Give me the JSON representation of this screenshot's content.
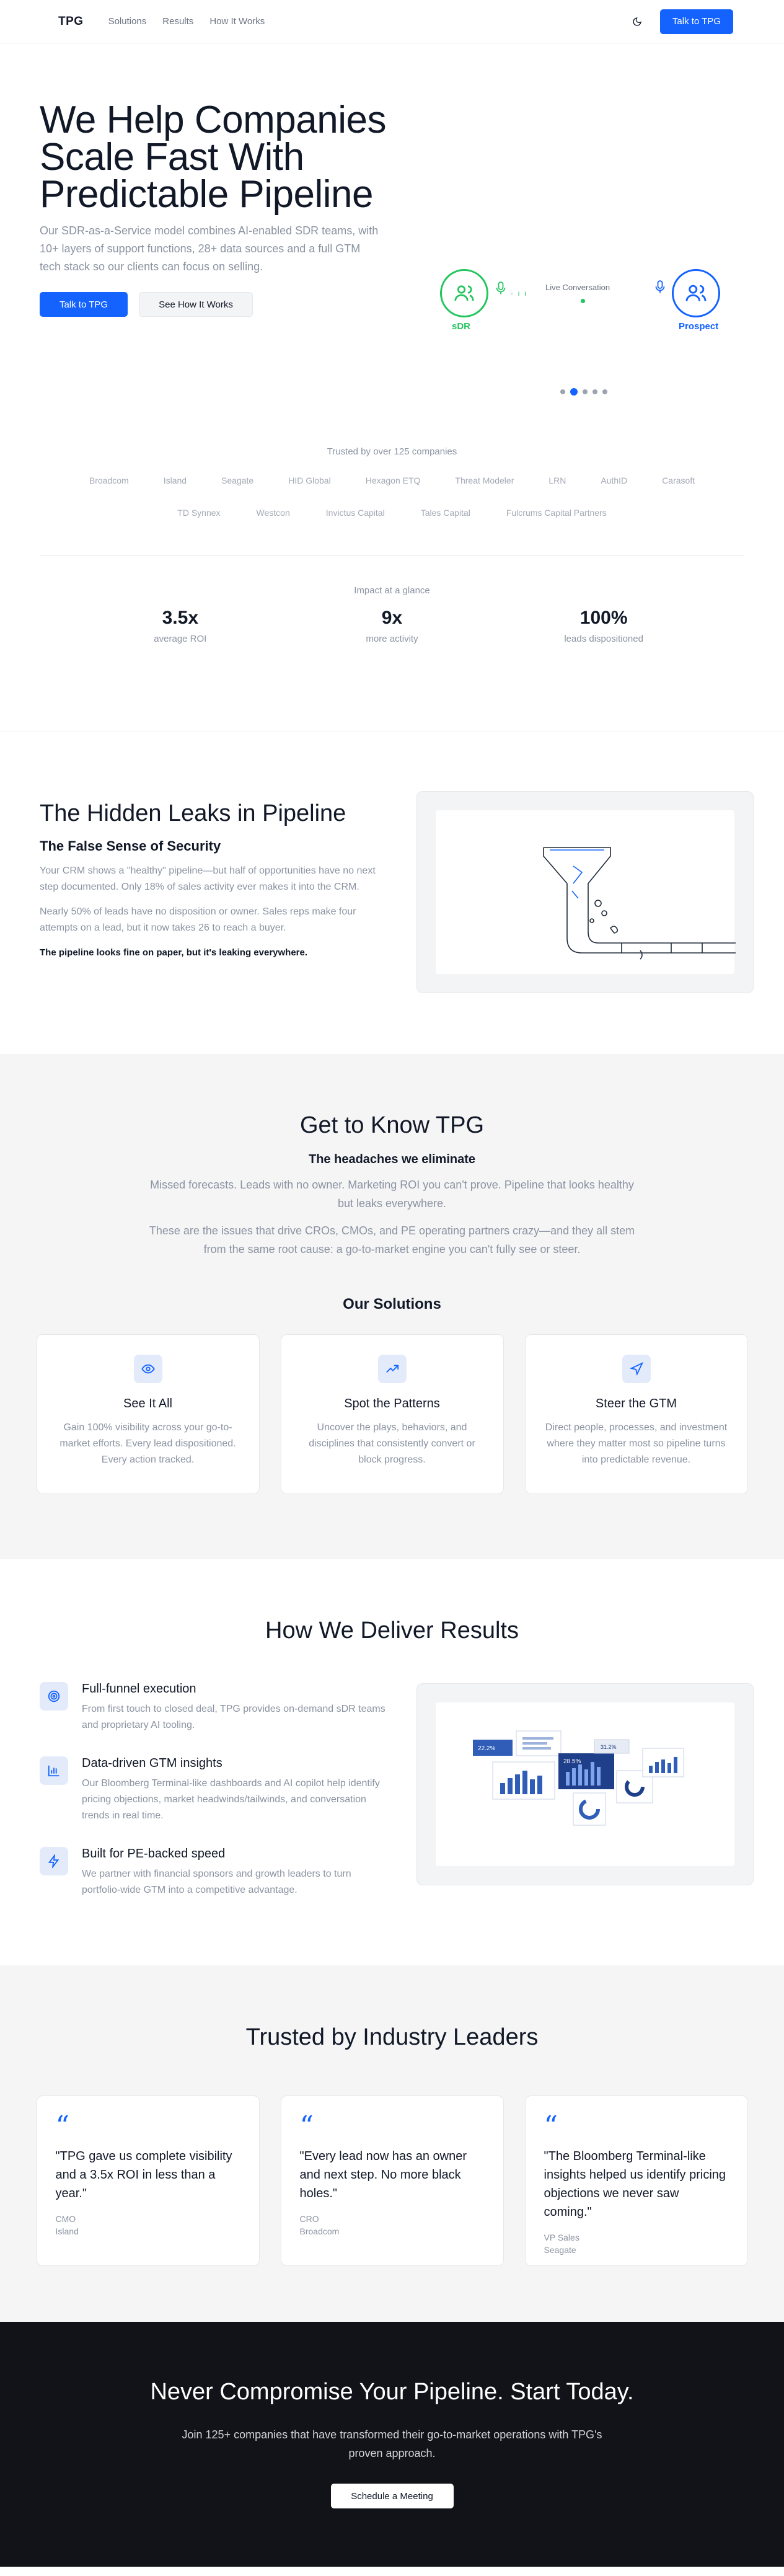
{
  "nav": {
    "logo": "TPG",
    "links": [
      "Solutions",
      "Results",
      "How It Works"
    ],
    "theme_icon": "moon-icon",
    "cta": "Talk to TPG"
  },
  "hero": {
    "title": "We Help Companies Scale Fast With Predictable Pipeline",
    "subtitle": "Our SDR-as-a-Service model combines AI-enabled SDR teams, with 10+ layers of support functions, 28+ data sources and a full GTM tech stack so our clients can focus on selling.",
    "primary_button": "Talk to TPG",
    "secondary_button": "See How It Works",
    "visual": {
      "left_label": "sDR",
      "right_label": "Prospect",
      "center_label": "Live Conversation",
      "green": "#22c55e",
      "blue": "#1463ff",
      "carousel_dots": 5,
      "active_dot": 2
    }
  },
  "trusted": {
    "title": "Trusted by over 125 companies",
    "row1": [
      "Broadcom",
      "Island",
      "Seagate",
      "HID Global",
      "Hexagon ETQ",
      "Threat Modeler",
      "LRN",
      "AuthID",
      "Carasoft"
    ],
    "row2": [
      "TD Synnex",
      "Westcon",
      "Invictus Capital",
      "Tales Capital",
      "Fulcrums Capital Partners"
    ]
  },
  "impact": {
    "title": "Impact at a glance",
    "stats": [
      {
        "value": "3.5x",
        "label": "average ROI"
      },
      {
        "value": "9x",
        "label": "more activity"
      },
      {
        "value": "100%",
        "label": "leads dispositioned"
      }
    ]
  },
  "leaks": {
    "title": "The Hidden Leaks in Pipeline",
    "subtitle": "The False Sense of Security",
    "p1": "Your CRM shows a \"healthy\" pipeline—but half of opportunities have no next step documented. Only 18% of sales activity ever makes it into the CRM.",
    "p2": "Nearly 50% of leads have no disposition or owner. Sales reps make four attempts on a lead, but it now takes 26 to reach a buyer.",
    "p3": "The pipeline looks fine on paper, but it's leaking everywhere."
  },
  "know": {
    "title": "Get to Know TPG",
    "subtitle": "The headaches we eliminate",
    "p1": "Missed forecasts. Leads with no owner. Marketing ROI you can't prove. Pipeline that looks healthy but leaks everywhere.",
    "p2": "These are the issues that drive CROs, CMOs, and PE operating partners crazy—and they all stem from the same root cause: a go-to-market engine you can't fully see or steer.",
    "solutions_title": "Our Solutions",
    "solutions": [
      {
        "icon": "eye-icon",
        "title": "See It All",
        "desc": "Gain 100% visibility across your go-to-market efforts. Every lead dispositioned. Every action tracked."
      },
      {
        "icon": "trending-up-icon",
        "title": "Spot the Patterns",
        "desc": "Uncover the plays, behaviors, and disciplines that consistently convert or block progress."
      },
      {
        "icon": "navigation-icon",
        "title": "Steer the GTM",
        "desc": "Direct people, processes, and investment where they matter most so pipeline turns into predictable revenue."
      }
    ]
  },
  "deliver": {
    "title": "How We Deliver Results",
    "features": [
      {
        "icon": "target-icon",
        "title": "Full-funnel execution",
        "desc": "From first touch to closed deal, TPG provides on-demand sDR teams and proprietary AI tooling."
      },
      {
        "icon": "bar-chart-icon",
        "title": "Data-driven GTM insights",
        "desc": "Our Bloomberg Terminal-like dashboards and AI copilot help identify pricing objections, market headwinds/tailwinds, and conversation trends in real time."
      },
      {
        "icon": "lightning-icon",
        "title": "Built for PE-backed speed",
        "desc": "We partner with financial sponsors and growth leaders to turn portfolio-wide GTM into a competitive advantage."
      }
    ],
    "dashboard_values": [
      "22.2%",
      "28.5%",
      "31.2%"
    ]
  },
  "testimonials": {
    "title": "Trusted by Industry Leaders",
    "items": [
      {
        "quote": "\"TPG gave us complete visibility and a 3.5x ROI in less than a year.\"",
        "role": "CMO",
        "company": "Island"
      },
      {
        "quote": "\"Every lead now has an owner and next step. No more black holes.\"",
        "role": "CRO",
        "company": "Broadcom"
      },
      {
        "quote": "\"The Bloomberg Terminal-like insights helped us identify pricing objections we never saw coming.\"",
        "role": "VP Sales",
        "company": "Seagate"
      }
    ]
  },
  "cta": {
    "title": "Never Compromise Your Pipeline. Start Today.",
    "subtitle": "Join 125+ companies that have transformed their go-to-market operations with TPG's proven approach.",
    "button": "Schedule a Meeting"
  }
}
